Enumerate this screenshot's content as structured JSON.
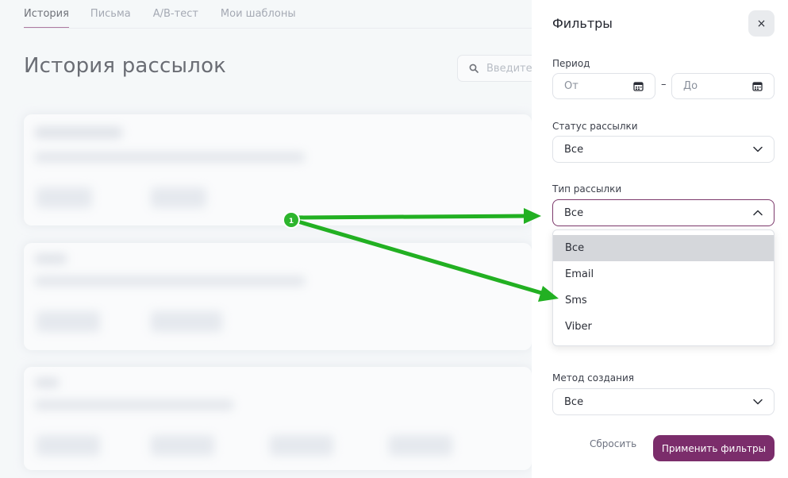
{
  "tabs": [
    {
      "label": "История"
    },
    {
      "label": "Письма"
    },
    {
      "label": "A/B-тест"
    },
    {
      "label": "Мои шаблоны"
    }
  ],
  "page": {
    "title": "История рассылок",
    "search_placeholder": "Введите"
  },
  "filters": {
    "title": "Фильтры",
    "close_label": "×",
    "period": {
      "label": "Период",
      "from_placeholder": "От",
      "to_placeholder": "До",
      "separator": "–"
    },
    "status": {
      "label": "Статус рассылки",
      "value": "Все"
    },
    "type": {
      "label": "Тип рассылки",
      "value": "Все",
      "options": [
        "Все",
        "Email",
        "Sms",
        "Viber"
      ]
    },
    "method": {
      "label": "Метод создания",
      "value": "Все"
    },
    "reset_label": "Сбросить",
    "apply_label": "Применить фильтры"
  },
  "annotation": {
    "marker": "1",
    "color": "#2db52d"
  },
  "colors": {
    "accent": "#7b2d6b",
    "arrow": "#22b022"
  }
}
